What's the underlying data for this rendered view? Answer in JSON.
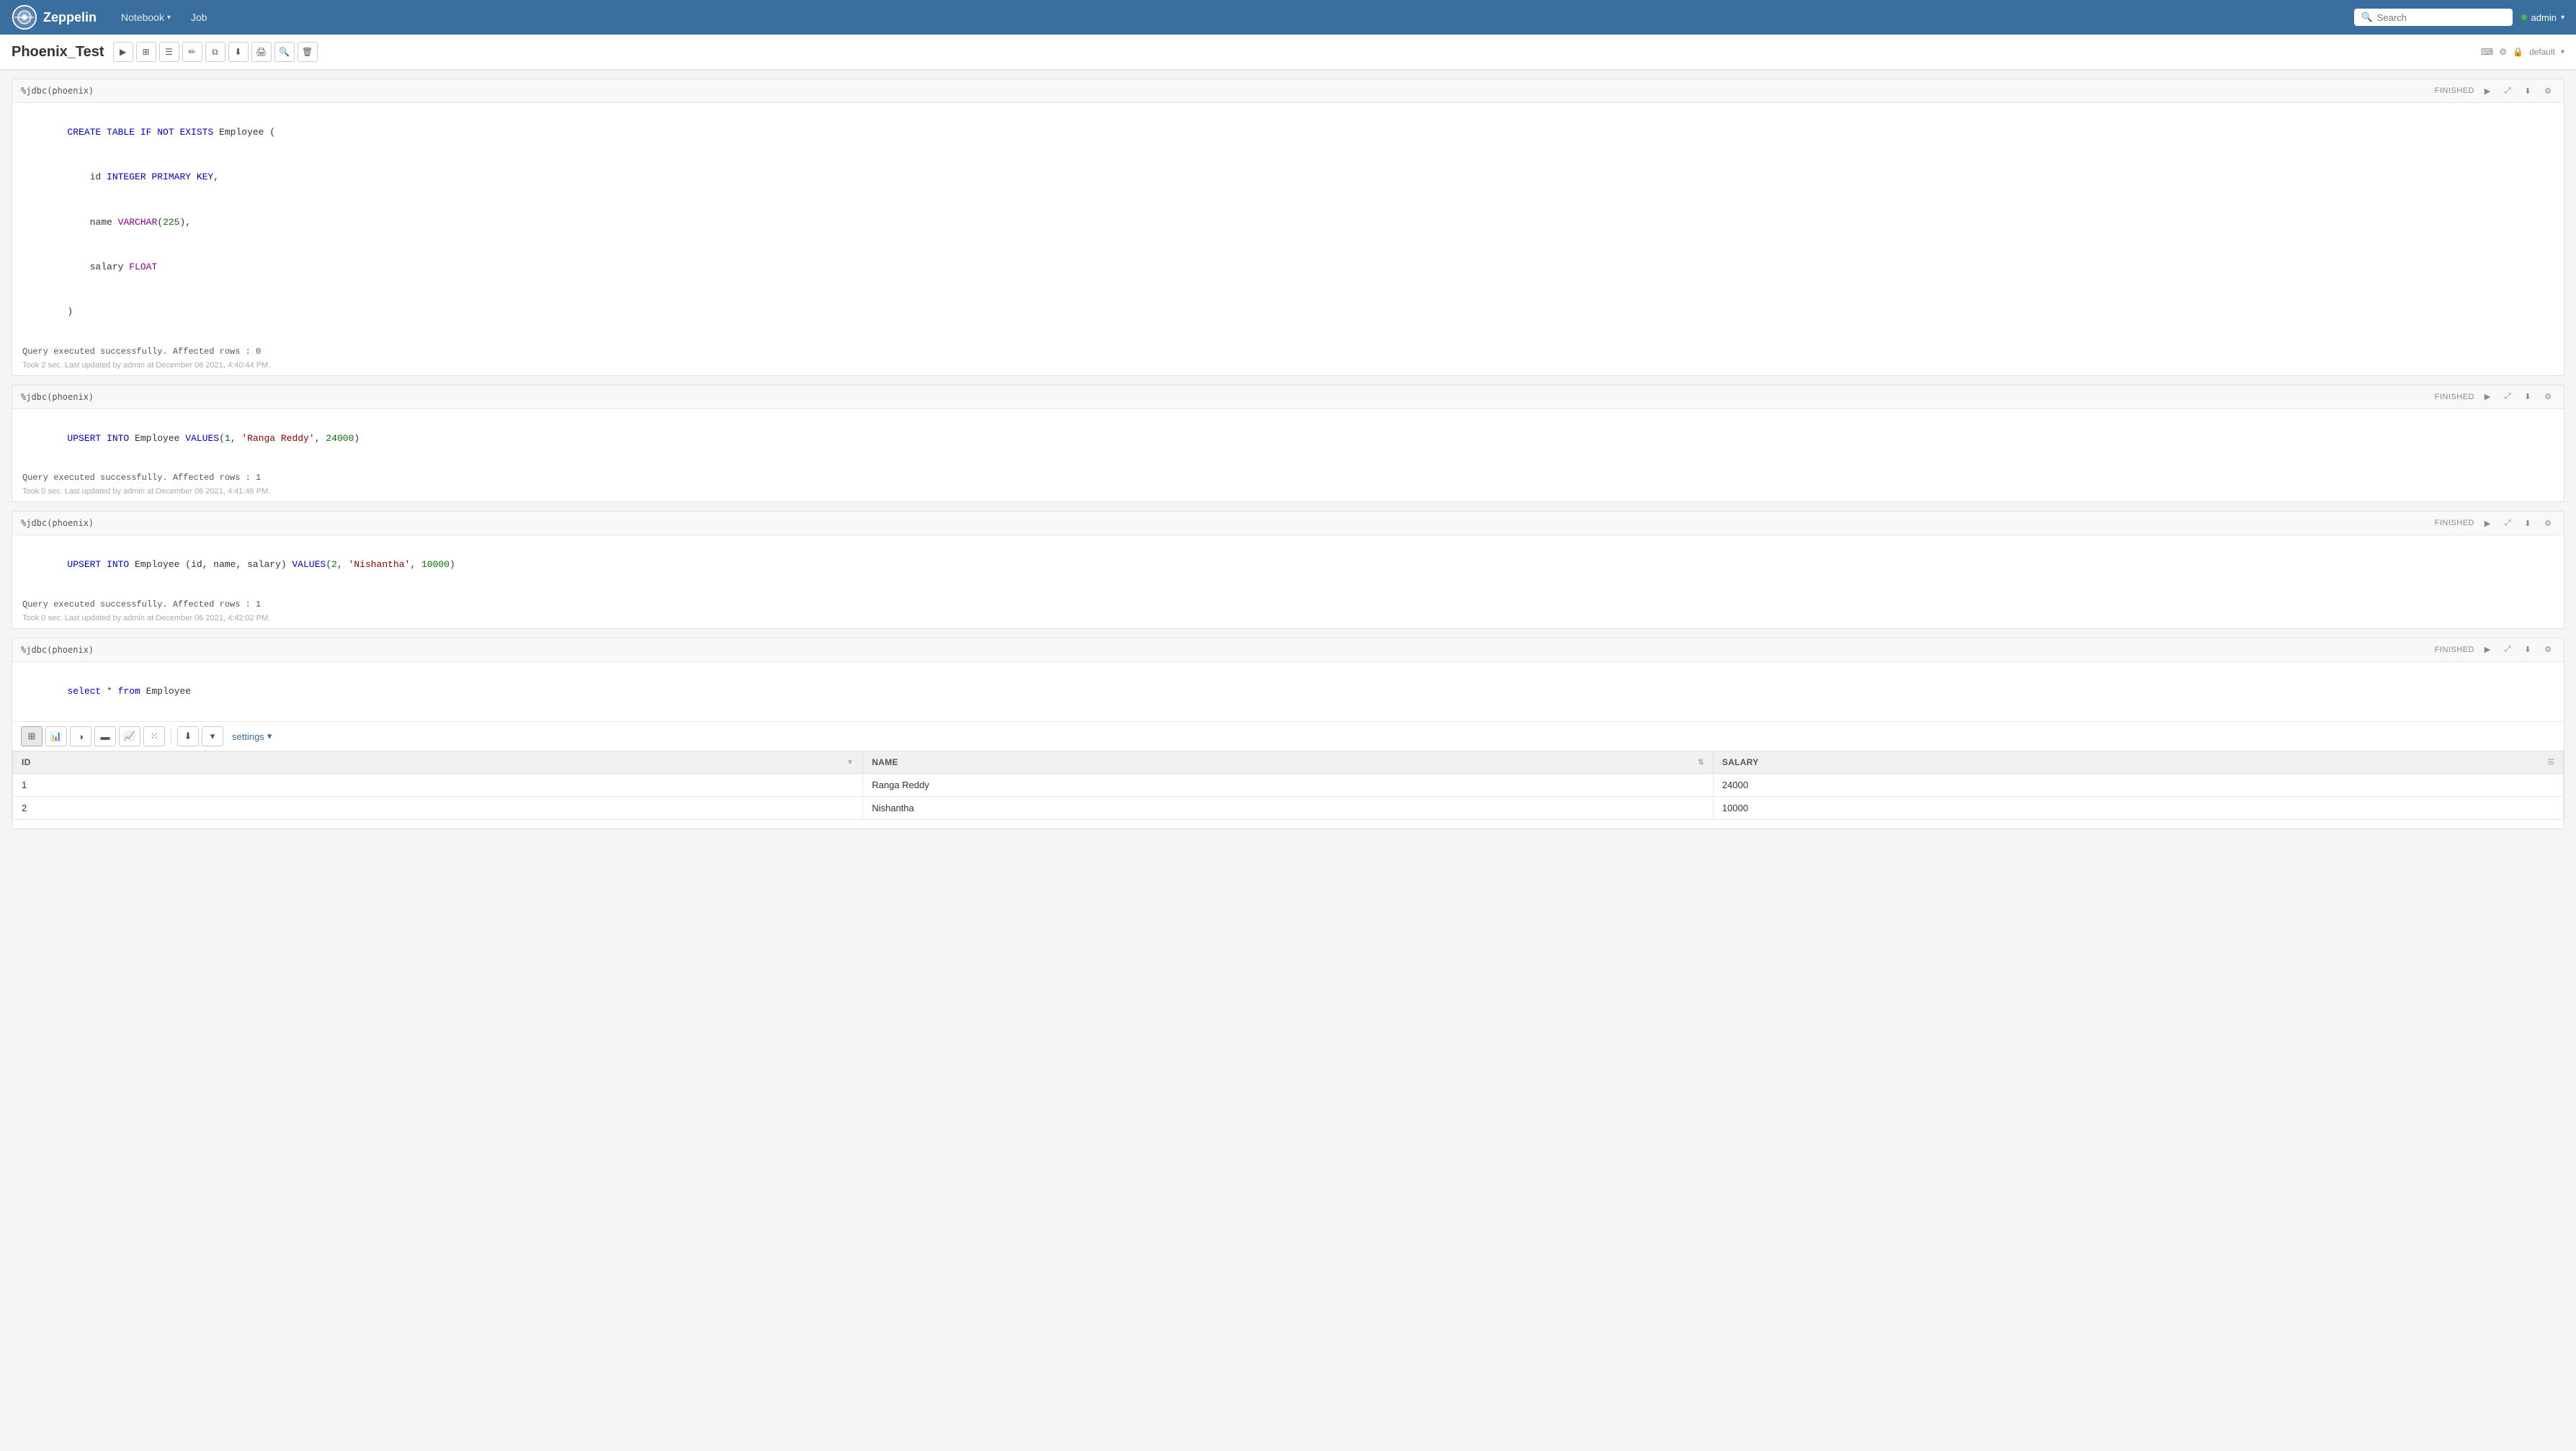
{
  "app": {
    "title": "Zeppelin"
  },
  "navbar": {
    "brand": "Zeppelin",
    "nav_items": [
      {
        "label": "Notebook",
        "has_arrow": true
      },
      {
        "label": "Job",
        "has_arrow": false
      }
    ],
    "search_placeholder": "Search",
    "user_label": "admin",
    "user_arrow": "▾"
  },
  "page": {
    "title": "Phoenix_Test",
    "default_label": "default"
  },
  "cells": [
    {
      "id": "cell1",
      "interpreter": "%jdbc(phoenix)",
      "status": "FINISHED",
      "code_lines": [
        {
          "type": "plain",
          "text": "CREATE TABLE IF NOT EXISTS Employee ("
        },
        {
          "type": "indent",
          "text": "    id INTEGER PRIMARY KEY,"
        },
        {
          "type": "indent",
          "text": "    name VARCHAR(225),"
        },
        {
          "type": "indent",
          "text": "    salary FLOAT"
        },
        {
          "type": "plain",
          "text": ")"
        }
      ],
      "output": "Query executed successfully. Affected rows : 0",
      "timestamp": "Took 2 sec. Last updated by admin at December 06 2021, 4:40:44 PM."
    },
    {
      "id": "cell2",
      "interpreter": "%jdbc(phoenix)",
      "status": "FINISHED",
      "code_lines": [
        {
          "type": "plain",
          "text": "UPSERT INTO Employee VALUES(1, 'Ranga Reddy', 24000)"
        }
      ],
      "output": "Query executed successfully. Affected rows : 1",
      "timestamp": "Took 0 sec. Last updated by admin at December 06 2021, 4:41:46 PM."
    },
    {
      "id": "cell3",
      "interpreter": "%jdbc(phoenix)",
      "status": "FINISHED",
      "code_lines": [
        {
          "type": "plain",
          "text": "UPSERT INTO Employee (id, name, salary) VALUES(2, 'Nishantha', 10000)"
        }
      ],
      "output": "Query executed successfully. Affected rows : 1",
      "timestamp": "Took 0 sec. Last updated by admin at December 06 2021, 4:42:02 PM."
    },
    {
      "id": "cell4",
      "interpreter": "%jdbc(phoenix)",
      "status": "FINISHED",
      "code_lines": [
        {
          "type": "select",
          "text": "select * from Employee"
        }
      ],
      "output": "",
      "timestamp": "",
      "has_table": true,
      "table": {
        "columns": [
          "ID",
          "NAME",
          "SALARY"
        ],
        "rows": [
          [
            "1",
            "Ranga Reddy",
            "24000"
          ],
          [
            "2",
            "Nishantha",
            "10000"
          ]
        ]
      }
    }
  ],
  "viz_buttons": [
    "table",
    "bar",
    "pie",
    "area-bar",
    "line",
    "scatter",
    "download",
    "more"
  ],
  "settings_label": "settings"
}
